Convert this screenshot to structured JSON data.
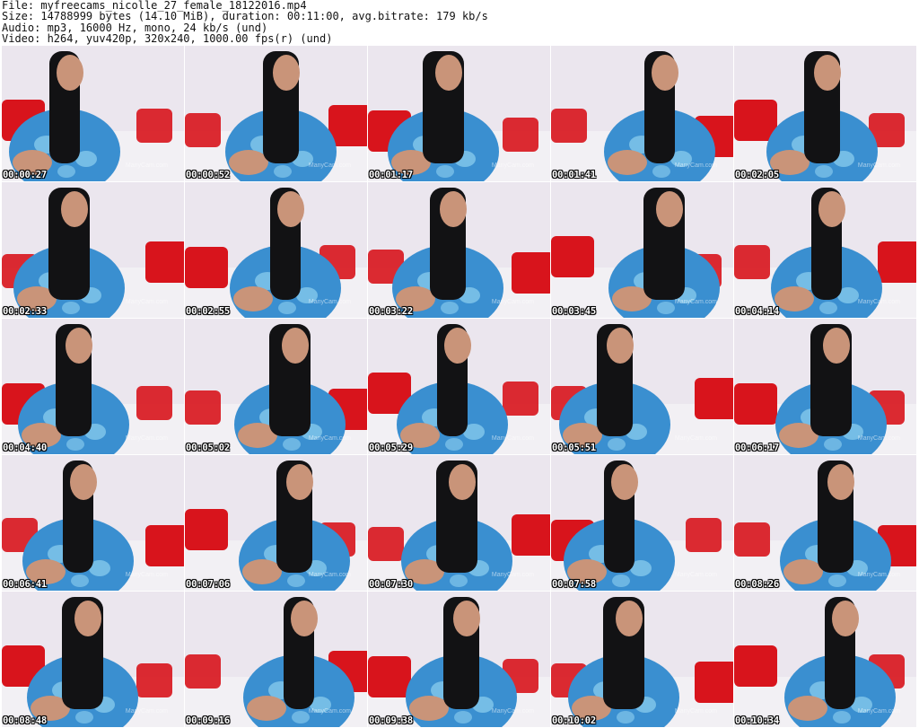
{
  "header": {
    "file": "File: myfreecams_nicolle_27_female_18122016.mp4",
    "size": "Size: 14788999 bytes (14.10 MiB), duration: 00:11:00, avg.bitrate: 179 kb/s",
    "audio": "Audio: mp3, 16000 Hz, mono, 24 kb/s (und)",
    "video": "Video: h264, yuv420p, 320x240, 1000.00 fps(r) (und)"
  },
  "watermark": "ManyCam.com",
  "colors": {
    "wall": "#ebe6ee",
    "pillow_red": "#d8141c",
    "dress_blue": "#3a8fd0",
    "dress_light": "#8fd0f0",
    "hair": "#121214",
    "skin": "#c99479",
    "bed": "#f2f0f4"
  },
  "thumbnails": [
    {
      "time": "00:00:27"
    },
    {
      "time": "00:00:52"
    },
    {
      "time": "00:01:17"
    },
    {
      "time": "00:01:41"
    },
    {
      "time": "00:02:05"
    },
    {
      "time": "00:02:33"
    },
    {
      "time": "00:02:55"
    },
    {
      "time": "00:03:22"
    },
    {
      "time": "00:03:45"
    },
    {
      "time": "00:04:14"
    },
    {
      "time": "00:04:40"
    },
    {
      "time": "00:05:02"
    },
    {
      "time": "00:05:29"
    },
    {
      "time": "00:05:51"
    },
    {
      "time": "00:06:17"
    },
    {
      "time": "00:06:41"
    },
    {
      "time": "00:07:06"
    },
    {
      "time": "00:07:30"
    },
    {
      "time": "00:07:58"
    },
    {
      "time": "00:08:26"
    },
    {
      "time": "00:08:48"
    },
    {
      "time": "00:09:16"
    },
    {
      "time": "00:09:38"
    },
    {
      "time": "00:10:02"
    },
    {
      "time": "00:10:34"
    }
  ]
}
